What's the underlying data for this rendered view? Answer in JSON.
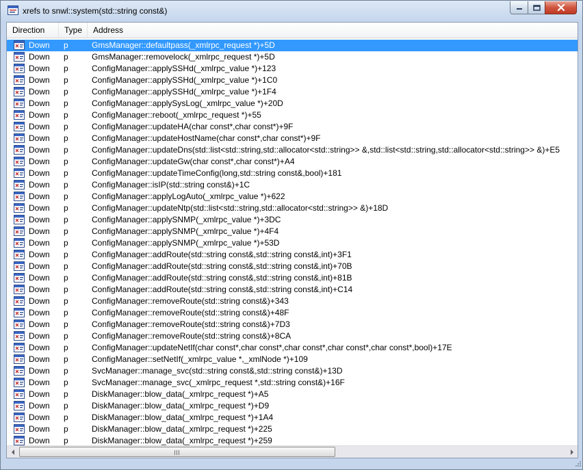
{
  "window": {
    "title": "xrefs to snwl::system(std::string const&)"
  },
  "columns": {
    "direction": "Direction",
    "type": "Type",
    "address": "Address"
  },
  "rows": [
    {
      "direction": "Down",
      "type": "p",
      "address": "GmsManager::defaultpass(_xmlrpc_request *)+5D"
    },
    {
      "direction": "Down",
      "type": "p",
      "address": "GmsManager::removelock(_xmlrpc_request *)+5D"
    },
    {
      "direction": "Down",
      "type": "p",
      "address": "ConfigManager::applySSHd(_xmlrpc_value *)+123"
    },
    {
      "direction": "Down",
      "type": "p",
      "address": "ConfigManager::applySSHd(_xmlrpc_value *)+1C0"
    },
    {
      "direction": "Down",
      "type": "p",
      "address": "ConfigManager::applySSHd(_xmlrpc_value *)+1F4"
    },
    {
      "direction": "Down",
      "type": "p",
      "address": "ConfigManager::applySysLog(_xmlrpc_value *)+20D"
    },
    {
      "direction": "Down",
      "type": "p",
      "address": "ConfigManager::reboot(_xmlrpc_request *)+55"
    },
    {
      "direction": "Down",
      "type": "p",
      "address": "ConfigManager::updateHA(char const*,char const*)+9F"
    },
    {
      "direction": "Down",
      "type": "p",
      "address": "ConfigManager::updateHostName(char const*,char const*)+9F"
    },
    {
      "direction": "Down",
      "type": "p",
      "address": "ConfigManager::updateDns(std::list<std::string,std::allocator<std::string>> &,std::list<std::string,std::allocator<std::string>> &)+E5"
    },
    {
      "direction": "Down",
      "type": "p",
      "address": "ConfigManager::updateGw(char const*,char const*)+A4"
    },
    {
      "direction": "Down",
      "type": "p",
      "address": "ConfigManager::updateTimeConfig(long,std::string const&,bool)+181"
    },
    {
      "direction": "Down",
      "type": "p",
      "address": "ConfigManager::isIP(std::string const&)+1C"
    },
    {
      "direction": "Down",
      "type": "p",
      "address": "ConfigManager::applyLogAuto(_xmlrpc_value *)+622"
    },
    {
      "direction": "Down",
      "type": "p",
      "address": "ConfigManager::updateNtp(std::list<std::string,std::allocator<std::string>> &)+18D"
    },
    {
      "direction": "Down",
      "type": "p",
      "address": "ConfigManager::applySNMP(_xmlrpc_value *)+3DC"
    },
    {
      "direction": "Down",
      "type": "p",
      "address": "ConfigManager::applySNMP(_xmlrpc_value *)+4F4"
    },
    {
      "direction": "Down",
      "type": "p",
      "address": "ConfigManager::applySNMP(_xmlrpc_value *)+53D"
    },
    {
      "direction": "Down",
      "type": "p",
      "address": "ConfigManager::addRoute(std::string const&,std::string const&,int)+3F1"
    },
    {
      "direction": "Down",
      "type": "p",
      "address": "ConfigManager::addRoute(std::string const&,std::string const&,int)+70B"
    },
    {
      "direction": "Down",
      "type": "p",
      "address": "ConfigManager::addRoute(std::string const&,std::string const&,int)+81B"
    },
    {
      "direction": "Down",
      "type": "p",
      "address": "ConfigManager::addRoute(std::string const&,std::string const&,int)+C14"
    },
    {
      "direction": "Down",
      "type": "p",
      "address": "ConfigManager::removeRoute(std::string const&)+343"
    },
    {
      "direction": "Down",
      "type": "p",
      "address": "ConfigManager::removeRoute(std::string const&)+48F"
    },
    {
      "direction": "Down",
      "type": "p",
      "address": "ConfigManager::removeRoute(std::string const&)+7D3"
    },
    {
      "direction": "Down",
      "type": "p",
      "address": "ConfigManager::removeRoute(std::string const&)+8CA"
    },
    {
      "direction": "Down",
      "type": "p",
      "address": "ConfigManager::updateNetIf(char const*,char const*,char const*,char const*,char const*,bool)+17E"
    },
    {
      "direction": "Down",
      "type": "p",
      "address": "ConfigManager::setNetIf(_xmlrpc_value *,_xmlNode *)+109"
    },
    {
      "direction": "Down",
      "type": "p",
      "address": "SvcManager::manage_svc(std::string const&,std::string const&)+13D"
    },
    {
      "direction": "Down",
      "type": "p",
      "address": "SvcManager::manage_svc(_xmlrpc_request *,std::string const&)+16F"
    },
    {
      "direction": "Down",
      "type": "p",
      "address": "DiskManager::blow_data(_xmlrpc_request *)+A5"
    },
    {
      "direction": "Down",
      "type": "p",
      "address": "DiskManager::blow_data(_xmlrpc_request *)+D9"
    },
    {
      "direction": "Down",
      "type": "p",
      "address": "DiskManager::blow_data(_xmlrpc_request *)+1A4"
    },
    {
      "direction": "Down",
      "type": "p",
      "address": "DiskManager::blow_data(_xmlrpc_request *)+225"
    },
    {
      "direction": "Down",
      "type": "p",
      "address": "DiskManager::blow_data(_xmlrpc_request *)+259"
    }
  ],
  "selected_row": 0,
  "colors": {
    "selection": "#3399ff",
    "close_button": "#c83c27"
  },
  "icons": {
    "window": "xref-list-icon",
    "row": "xref-code-icon",
    "minimize": "minimize-icon",
    "maximize": "maximize-icon",
    "close": "close-icon",
    "scroll_left": "arrow-left-icon",
    "scroll_right": "arrow-right-icon"
  }
}
